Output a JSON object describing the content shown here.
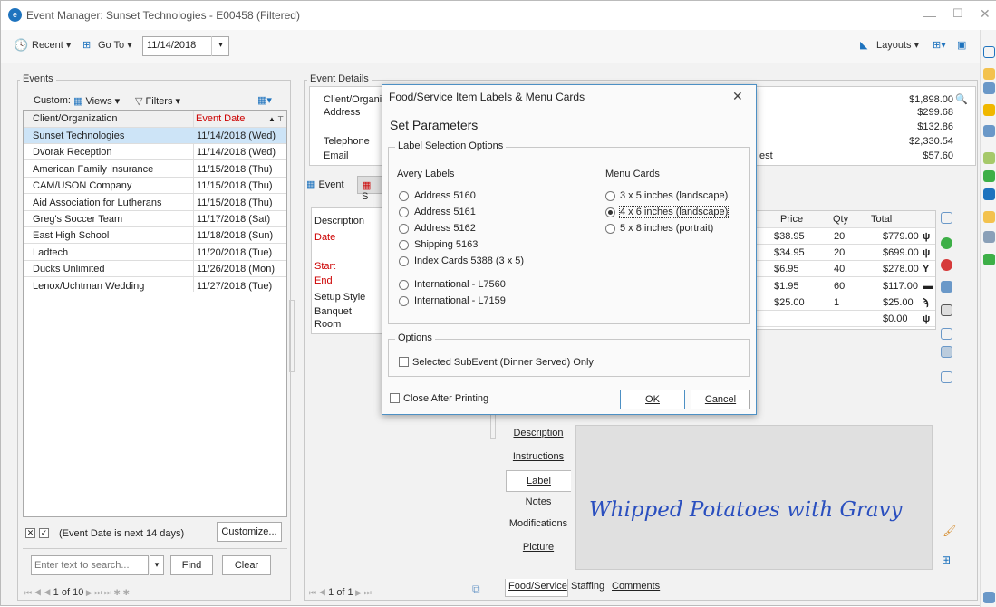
{
  "title": "Event Manager: Sunset Technologies - E00458 (Filtered)",
  "toolbar": {
    "recent": "Recent",
    "goto": "Go To",
    "date": "11/14/2018",
    "layouts": "Layouts"
  },
  "events": {
    "panel": "Events",
    "custom": "Custom:",
    "views": "Views",
    "filters": "Filters",
    "columns": [
      "Client/Organization",
      "Event Date"
    ],
    "rows": [
      [
        "Sunset Technologies",
        "11/14/2018 (Wed)"
      ],
      [
        "Dvorak Reception",
        "11/14/2018 (Wed)"
      ],
      [
        "American Family Insurance",
        "11/15/2018 (Thu)"
      ],
      [
        "CAM/USON Company",
        "11/15/2018 (Thu)"
      ],
      [
        "Aid Association for Lutherans",
        "11/15/2018 (Thu)"
      ],
      [
        "Greg's Soccer Team",
        "11/17/2018 (Sat)"
      ],
      [
        "East High School",
        "11/18/2018 (Sun)"
      ],
      [
        "Ladtech",
        "11/20/2018 (Tue)"
      ],
      [
        "Ducks Unlimited",
        "11/26/2018 (Mon)"
      ],
      [
        "Lenox/Uchtman Wedding",
        "11/27/2018 (Tue)"
      ]
    ],
    "filter_text": "(Event Date is next 14 days)",
    "customize": "Customize...",
    "search_placeholder": "Enter text to search...",
    "find": "Find",
    "clear": "Clear",
    "pager": "1 of 10"
  },
  "details": {
    "panel": "Event Details",
    "client_label": "Client/Organi",
    "address": "Address",
    "telephone": "Telephone",
    "email": "Email",
    "amounts": [
      "$1,898.00",
      "$299.68",
      "$132.86",
      "$2,330.54",
      "$57.60"
    ],
    "est": "est",
    "tab_event": "Event",
    "tab_s": "S",
    "desc_labels": [
      "Description",
      "Date",
      "",
      "Start",
      "End",
      "Setup Style",
      "Banquet",
      "Room"
    ],
    "fs_headers": [
      "Price",
      "Qty",
      "Total"
    ],
    "fs_rows": [
      [
        "$38.95",
        "20",
        "$779.00"
      ],
      [
        "$34.95",
        "20",
        "$699.00"
      ],
      [
        "$6.95",
        "40",
        "$278.00"
      ],
      [
        "$1.95",
        "60",
        "$117.00"
      ],
      [
        "$25.00",
        "1",
        "$25.00"
      ],
      [
        "",
        "",
        "$0.00"
      ]
    ],
    "pager": "1 of 1",
    "tabs": [
      "Description",
      "Instructions",
      "Label",
      "Notes",
      "Modifications",
      "Picture"
    ],
    "preview": "Whipped Potatoes with Gravy",
    "bottom_tabs": [
      "Food/Service",
      "Staffing",
      "Comments"
    ]
  },
  "dialog": {
    "title": "Food/Service Item Labels & Menu Cards",
    "heading": "Set Parameters",
    "group": "Label Selection Options",
    "avery": "Avery Labels",
    "menu": "Menu Cards",
    "avery_opts": [
      "Address 5160",
      "Address 5161",
      "Address 5162",
      "Shipping 5163",
      "Index Cards 5388 (3 x 5)",
      "International - L7560",
      "International - L7159"
    ],
    "menu_opts": [
      "3 x 5 inches (landscape)",
      "4 x 6 inches (landscape)",
      "5 x 8 inches (portrait)"
    ],
    "options": "Options",
    "sub_only": "Selected SubEvent (Dinner Served)  Only",
    "close_after": "Close After Printing",
    "ok": "OK",
    "cancel": "Cancel"
  }
}
